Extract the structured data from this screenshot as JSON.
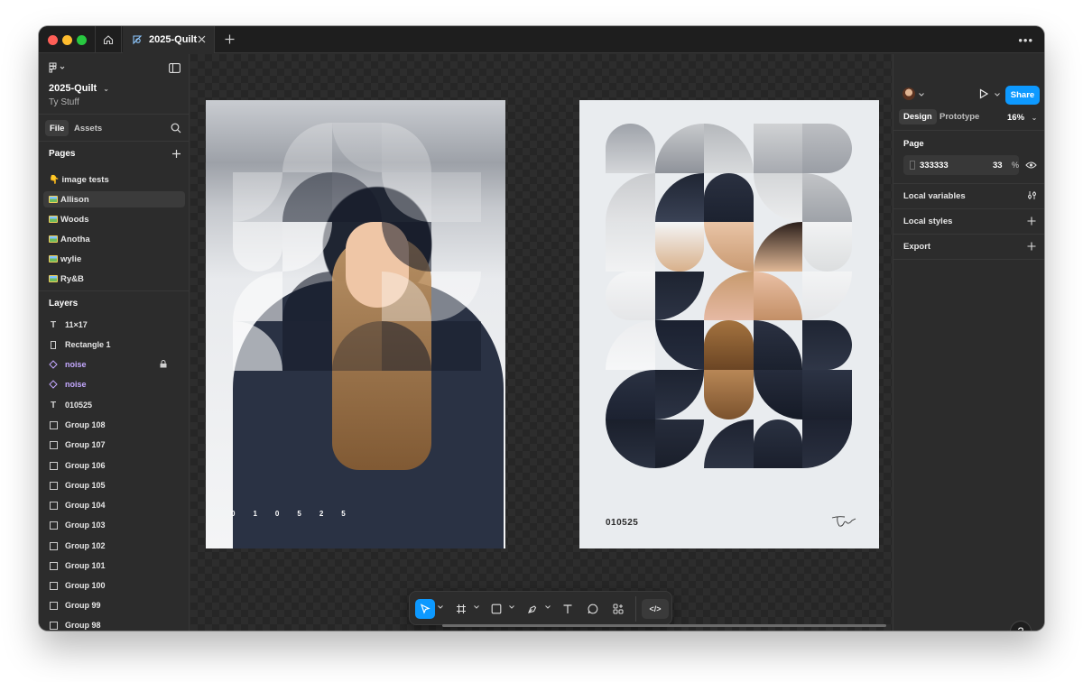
{
  "titlebar": {
    "tab_title": "2025-Quilt"
  },
  "left_panel": {
    "file_name": "2025-Quilt",
    "team_name": "Ty Stuff",
    "tabs": [
      "File",
      "Assets"
    ],
    "pages_heading": "Pages",
    "pages": [
      {
        "label": "👇 image tests",
        "emoji": true
      },
      {
        "label": "Allison",
        "thumb": true,
        "selected": true
      },
      {
        "label": "Woods",
        "thumb": true
      },
      {
        "label": "Anotha",
        "thumb": true
      },
      {
        "label": "wylie",
        "thumb": true
      },
      {
        "label": "Ry&B",
        "thumb": true
      }
    ],
    "layers_heading": "Layers",
    "layers": [
      {
        "label": "11×17",
        "icon": "text-icon"
      },
      {
        "label": "Rectangle 1",
        "icon": "rectangle-icon"
      },
      {
        "label": "noise",
        "icon": "component-icon",
        "locked": true
      },
      {
        "label": "noise",
        "icon": "component-icon"
      },
      {
        "label": "010525",
        "icon": "text-icon"
      },
      {
        "label": "Group 108",
        "icon": "group-icon"
      },
      {
        "label": "Group 107",
        "icon": "group-icon"
      },
      {
        "label": "Group 106",
        "icon": "group-icon"
      },
      {
        "label": "Group 105",
        "icon": "group-icon"
      },
      {
        "label": "Group 104",
        "icon": "group-icon"
      },
      {
        "label": "Group 103",
        "icon": "group-icon"
      },
      {
        "label": "Group 102",
        "icon": "group-icon"
      },
      {
        "label": "Group 101",
        "icon": "group-icon"
      },
      {
        "label": "Group 100",
        "icon": "group-icon"
      },
      {
        "label": "Group 99",
        "icon": "group-icon"
      },
      {
        "label": "Group 98",
        "icon": "group-icon"
      }
    ]
  },
  "canvas": {
    "frame_a_digits": [
      "0",
      "1",
      "0",
      "5",
      "2",
      "5"
    ],
    "frame_b_code": "010525"
  },
  "toolbar": {
    "tools": [
      "move-tool",
      "frame-tool",
      "shape-tool",
      "pen-tool",
      "text-tool",
      "comment-tool",
      "actions-tool"
    ],
    "dev_mode_label": "</>"
  },
  "right_panel": {
    "share_label": "Share",
    "tabs": [
      "Design",
      "Prototype"
    ],
    "zoom": "16%",
    "page_heading": "Page",
    "page_color_hex": "333333",
    "page_color_opacity": "33",
    "page_color_unit": "%",
    "sections": [
      "Local variables",
      "Local styles",
      "Export"
    ],
    "help_label": "?"
  },
  "colors": {
    "accent": "#0d99ff",
    "component": "#c4a8ff",
    "panel": "#2c2c2c",
    "titlebar": "#1e1e1e"
  }
}
